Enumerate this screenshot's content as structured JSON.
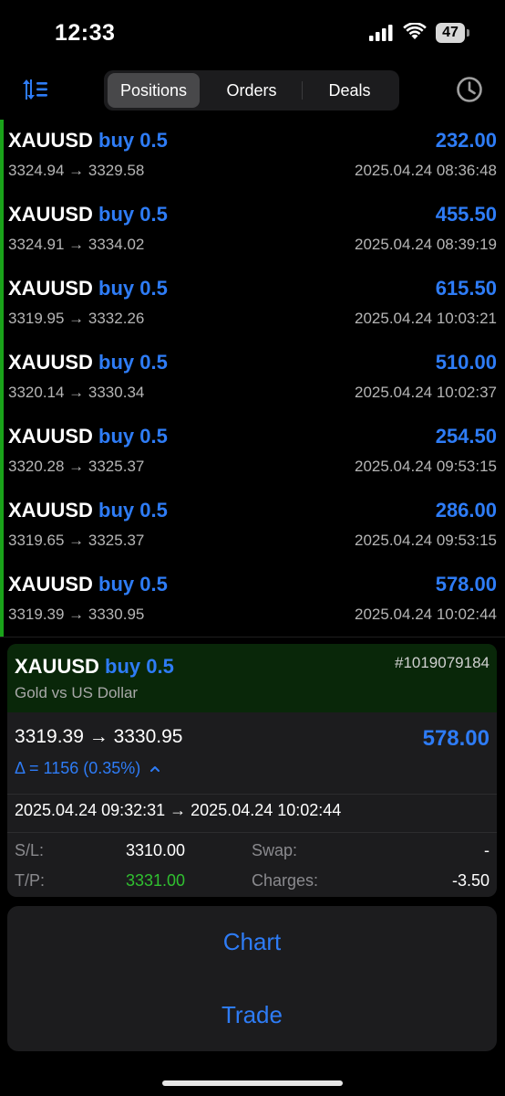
{
  "status": {
    "time": "12:33",
    "battery": "47"
  },
  "toolbar": {
    "tabs": [
      "Positions",
      "Orders",
      "Deals"
    ],
    "active_tab": "Positions"
  },
  "positions": [
    {
      "symbol": "XAUUSD",
      "side": "buy 0.5",
      "profit": "232.00",
      "prices": "3324.94 → 3329.58",
      "datetime": "2025.04.24 08:36:48"
    },
    {
      "symbol": "XAUUSD",
      "side": "buy 0.5",
      "profit": "455.50",
      "prices": "3324.91 → 3334.02",
      "datetime": "2025.04.24 08:39:19"
    },
    {
      "symbol": "XAUUSD",
      "side": "buy 0.5",
      "profit": "615.50",
      "prices": "3319.95 → 3332.26",
      "datetime": "2025.04.24 10:03:21"
    },
    {
      "symbol": "XAUUSD",
      "side": "buy 0.5",
      "profit": "510.00",
      "prices": "3320.14 → 3330.34",
      "datetime": "2025.04.24 10:02:37"
    },
    {
      "symbol": "XAUUSD",
      "side": "buy 0.5",
      "profit": "254.50",
      "prices": "3320.28 → 3325.37",
      "datetime": "2025.04.24 09:53:15"
    },
    {
      "symbol": "XAUUSD",
      "side": "buy 0.5",
      "profit": "286.00",
      "prices": "3319.65 → 3325.37",
      "datetime": "2025.04.24 09:53:15"
    },
    {
      "symbol": "XAUUSD",
      "side": "buy 0.5",
      "profit": "578.00",
      "prices": "3319.39 → 3330.95",
      "datetime": "2025.04.24 10:02:44"
    }
  ],
  "detail": {
    "symbol": "XAUUSD",
    "side": "buy 0.5",
    "ticket": "#1019079184",
    "description": "Gold vs US Dollar",
    "prices": "3319.39 → 3330.95",
    "profit": "578.00",
    "delta": "Δ = 1156 (0.35%)",
    "time_range": "2025.04.24 09:32:31 → 2025.04.24 10:02:44",
    "sl_label": "S/L:",
    "sl_value": "3310.00",
    "tp_label": "T/P:",
    "tp_value": "3331.00",
    "swap_label": "Swap:",
    "swap_value": "-",
    "charges_label": "Charges:",
    "charges_value": "-3.50"
  },
  "actions": {
    "chart": "Chart",
    "trade": "Trade"
  },
  "colors": {
    "accent": "#2e7cf6",
    "positive": "#30c030",
    "header_bg": "#092709",
    "bar": "#1aa31a"
  }
}
